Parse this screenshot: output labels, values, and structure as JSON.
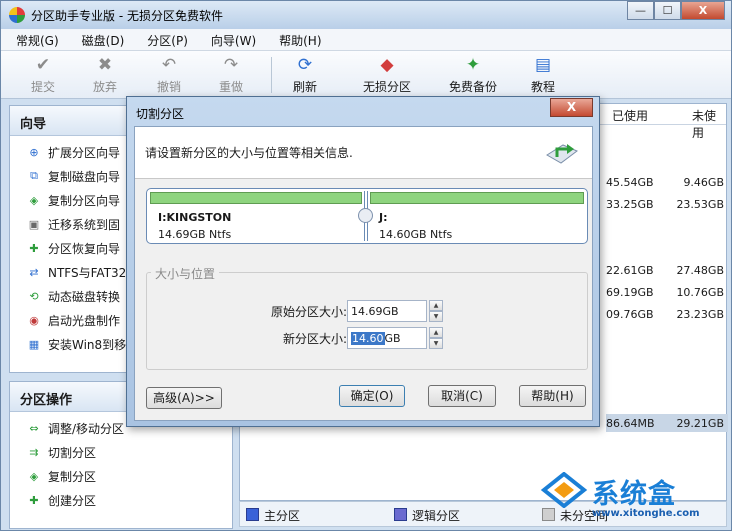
{
  "window": {
    "title": "分区助手专业版 - 无损分区免费软件",
    "minimize": "—",
    "maximize": "☐",
    "close": "X"
  },
  "menu": [
    "常规(G)",
    "磁盘(D)",
    "分区(P)",
    "向导(W)",
    "帮助(H)"
  ],
  "toolbar": [
    {
      "label": "提交",
      "icon": "check-icon",
      "glyph": "✔",
      "enabled": false
    },
    {
      "label": "放弃",
      "icon": "discard-icon",
      "glyph": "✖",
      "enabled": false
    },
    {
      "label": "撤销",
      "icon": "undo-icon",
      "glyph": "↶",
      "enabled": false
    },
    {
      "label": "重做",
      "icon": "redo-icon",
      "glyph": "↷",
      "enabled": false
    },
    {
      "label": "刷新",
      "icon": "refresh-icon",
      "glyph": "⟳",
      "enabled": true
    },
    {
      "label": "无损分区",
      "icon": "lossless-partition-icon",
      "glyph": "◆",
      "enabled": true
    },
    {
      "label": "免费备份",
      "icon": "free-backup-icon",
      "glyph": "✦",
      "enabled": true
    },
    {
      "label": "教程",
      "icon": "tutorial-icon",
      "glyph": "▤",
      "enabled": true
    }
  ],
  "sidebar": {
    "wizard_title": "向导",
    "wizard_items": [
      "扩展分区向导",
      "复制磁盘向导",
      "复制分区向导",
      "迁移系统到固",
      "分区恢复向导",
      "NTFS与FAT32转",
      "动态磁盘转换",
      "启动光盘制作",
      "安装Win8到移"
    ],
    "ops_title": "分区操作",
    "ops_items": [
      "调整/移动分区",
      "切割分区",
      "复制分区",
      "创建分区"
    ]
  },
  "table": {
    "headers": [
      "已使用",
      "未使用"
    ],
    "rows": [
      [
        "45.54GB",
        "9.46GB"
      ],
      [
        "33.25GB",
        "23.53GB"
      ],
      [
        "22.61GB",
        "27.48GB"
      ],
      [
        "69.19GB",
        "10.76GB"
      ],
      [
        "09.76GB",
        "23.23GB"
      ],
      [
        "86.64MB",
        "29.21GB"
      ]
    ]
  },
  "statusbar": {
    "primary": "主分区",
    "logical": "逻辑分区",
    "unallocated": "未分空间"
  },
  "watermark": {
    "brand": "系统盒",
    "url": "www.xitonghe.com"
  },
  "dialog": {
    "title": "切割分区",
    "close": "X",
    "instruction": "请设置新分区的大小与位置等相关信息.",
    "left_partition": {
      "name": "I:KINGSTON",
      "info": "14.69GB Ntfs"
    },
    "right_partition": {
      "name": "J:",
      "info": "14.60GB Ntfs"
    },
    "group_label": "大小与位置",
    "original_label": "原始分区大小:",
    "original_value": "14.69GB",
    "new_label": "新分区大小:",
    "new_value_selected": "14.60",
    "new_value_unit": "GB",
    "advanced": "高级(A)>>",
    "ok": "确定(O)",
    "cancel": "取消(C)",
    "help": "帮助(H)"
  }
}
